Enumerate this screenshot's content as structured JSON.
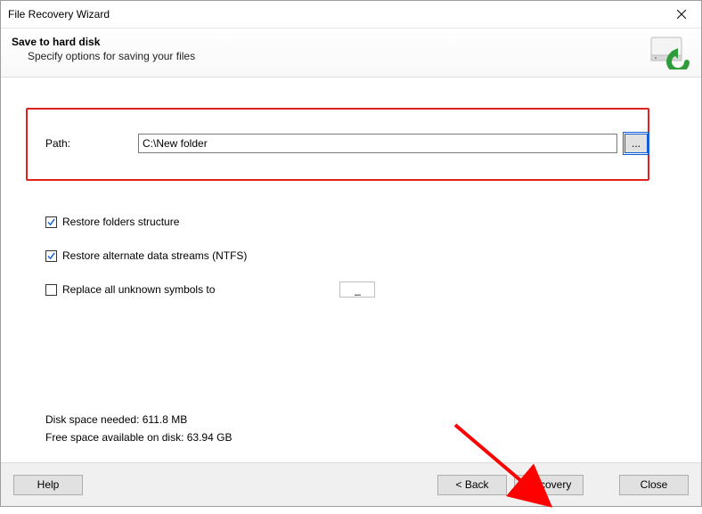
{
  "window": {
    "title": "File Recovery Wizard"
  },
  "header": {
    "title": "Save to hard disk",
    "subtitle": "Specify options for saving your files"
  },
  "path": {
    "label": "Path:",
    "value": "C:\\New folder",
    "browse_label": "..."
  },
  "options": {
    "restore_structure": {
      "label": "Restore folders structure",
      "checked": true
    },
    "restore_ads": {
      "label": "Restore alternate data streams (NTFS)",
      "checked": true
    },
    "replace_symbols": {
      "label": "Replace all unknown symbols to",
      "checked": false,
      "value": "_"
    }
  },
  "stats": {
    "needed": "Disk space needed: 611.8 MB",
    "free": "Free space available on disk: 63.94 GB"
  },
  "buttons": {
    "help": "Help",
    "back": "< Back",
    "recovery": "Recovery",
    "close": "Close"
  }
}
